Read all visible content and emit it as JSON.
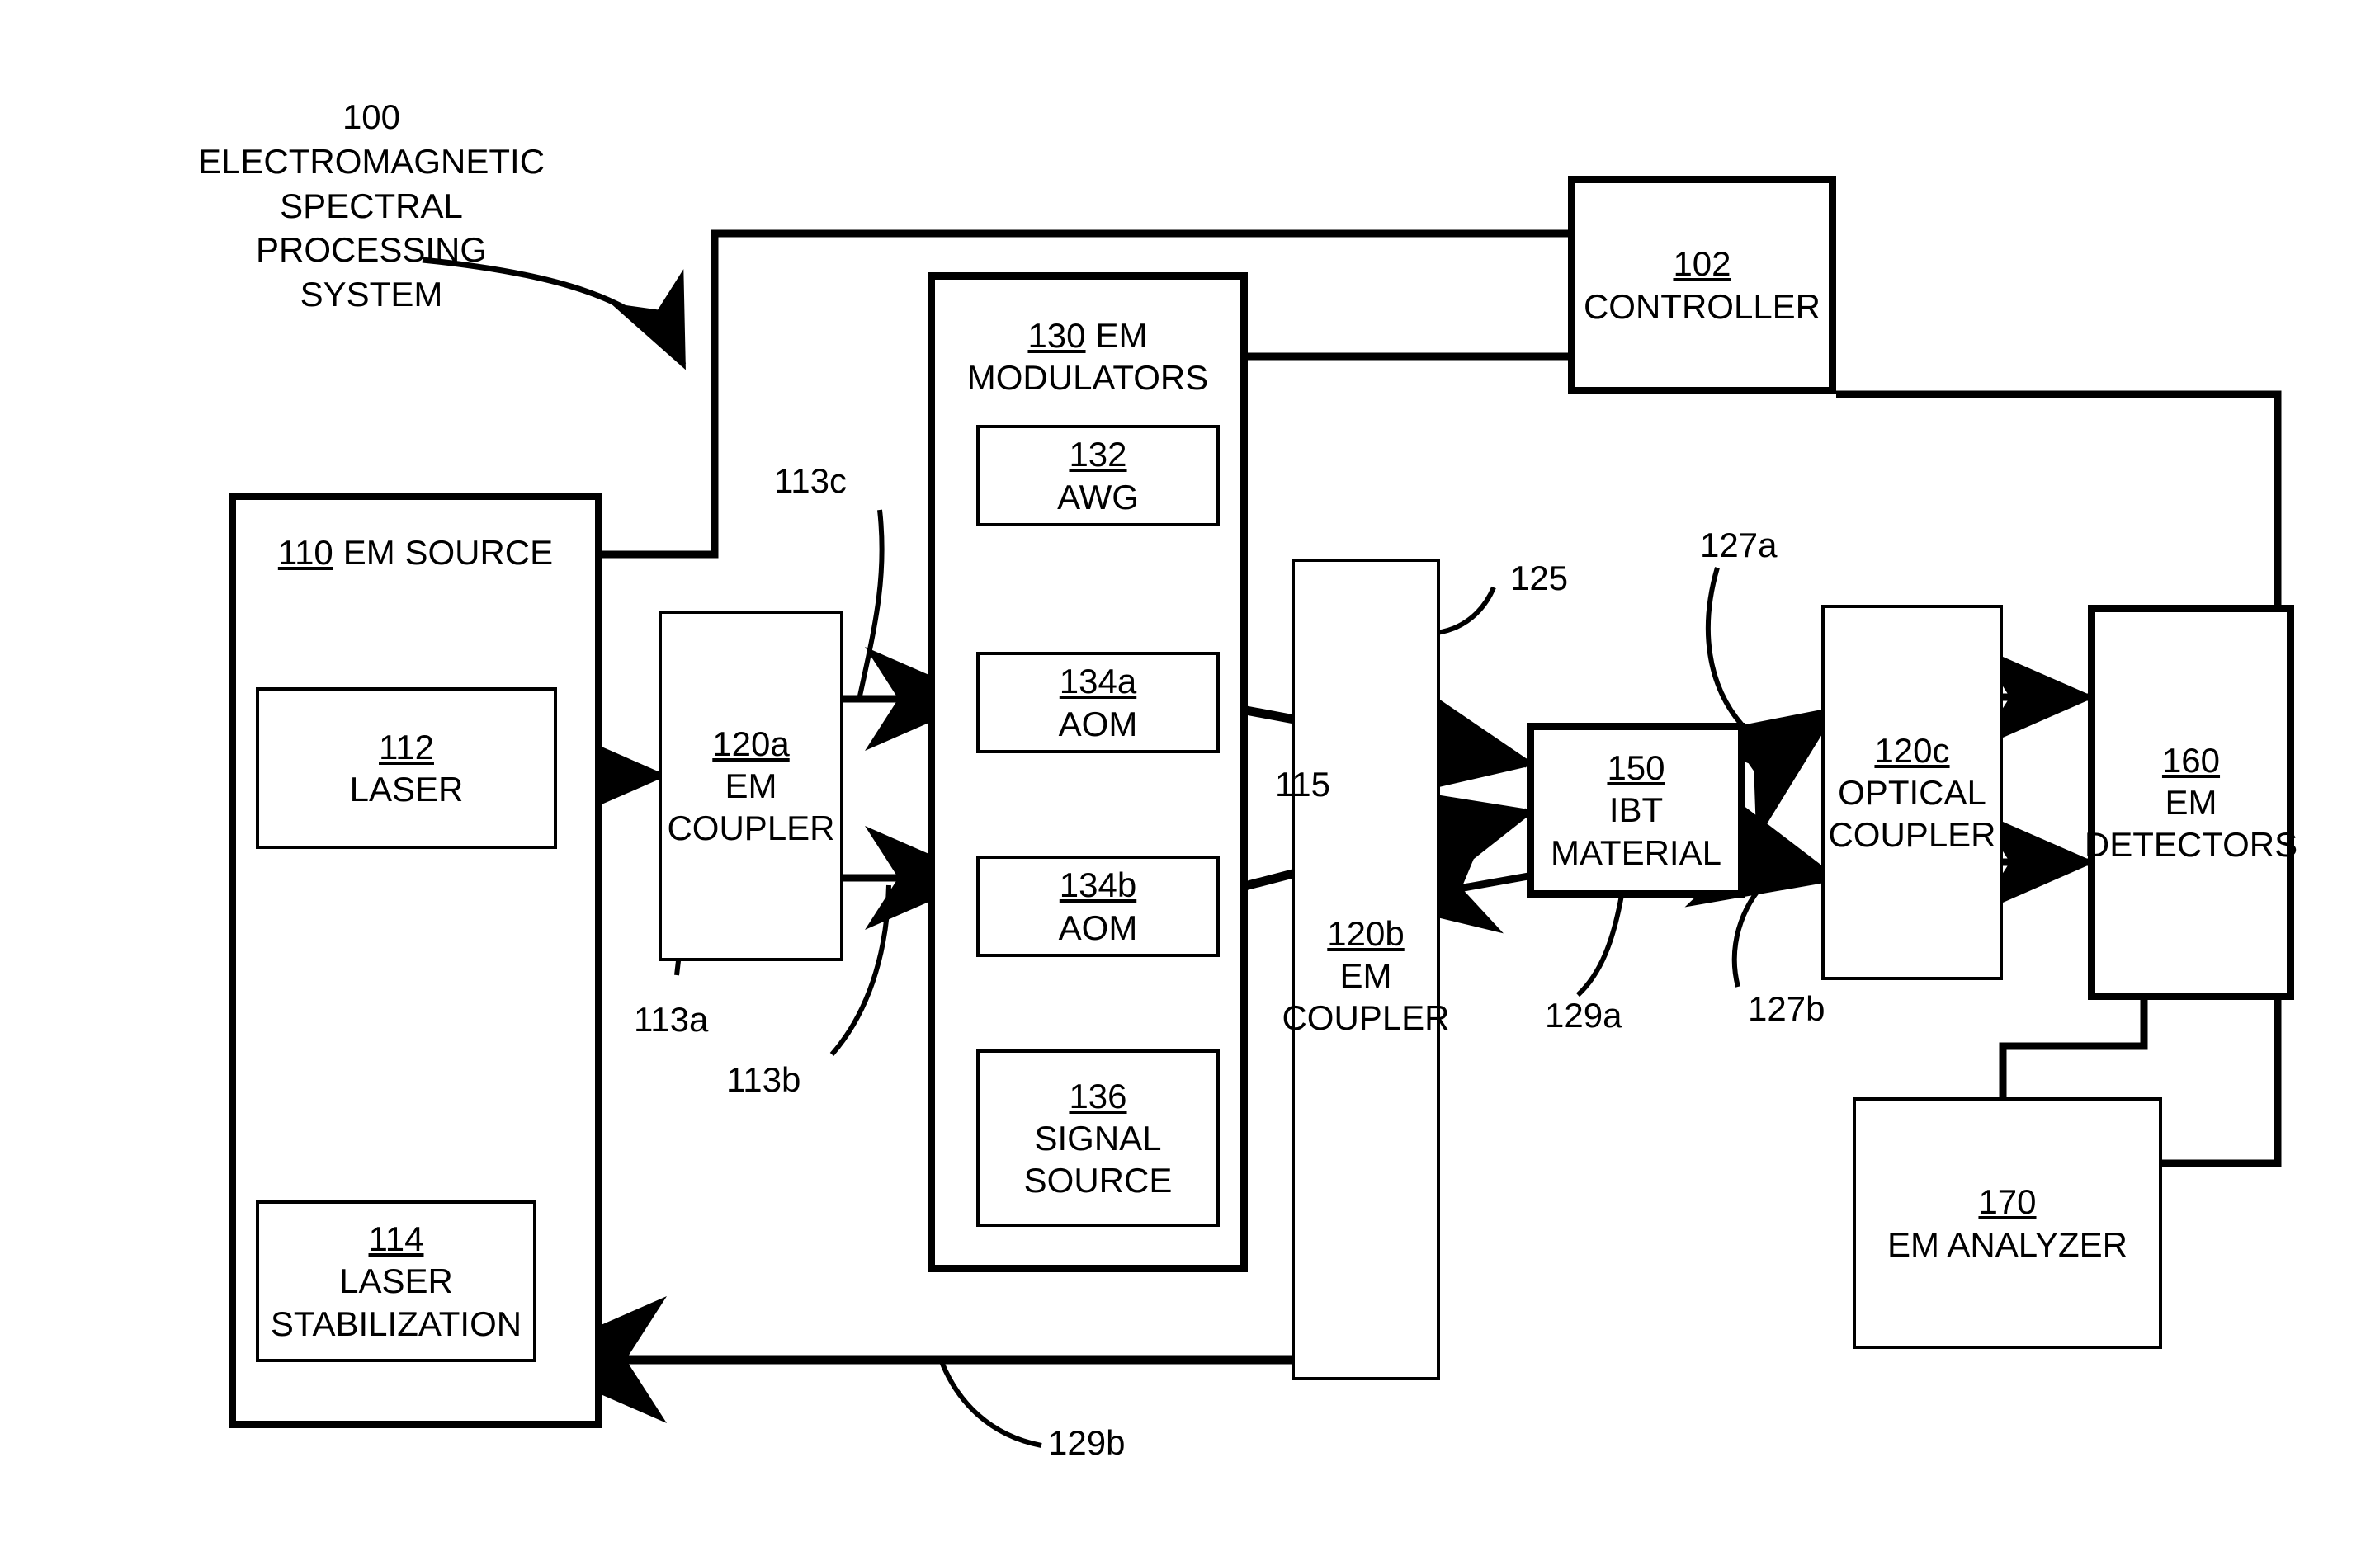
{
  "figure": {
    "title_ref": "100",
    "title_lines": [
      "ELECTROMAGNETIC",
      "SPECTRAL",
      "PROCESSING",
      "SYSTEM"
    ]
  },
  "blocks": {
    "controller": {
      "ref": "102",
      "lines": [
        "CONTROLLER"
      ]
    },
    "em_source": {
      "ref": "110",
      "inline_label": "EM SOURCE"
    },
    "laser": {
      "ref": "112",
      "lines": [
        "LASER"
      ]
    },
    "laser_stab": {
      "ref": "114",
      "lines": [
        "LASER",
        "STABILIZATION"
      ]
    },
    "em_coupler_a": {
      "ref": "120a",
      "lines": [
        "EM",
        "COUPLER"
      ]
    },
    "em_modulators": {
      "ref": "130",
      "inline_label": "EM",
      "lines": [
        "MODULATORS"
      ]
    },
    "awg": {
      "ref": "132",
      "lines": [
        "AWG"
      ]
    },
    "aom_a": {
      "ref": "134a",
      "lines": [
        "AOM"
      ]
    },
    "aom_b": {
      "ref": "134b",
      "lines": [
        "AOM"
      ]
    },
    "signal_source": {
      "ref": "136",
      "lines": [
        "SIGNAL",
        "SOURCE"
      ]
    },
    "em_coupler_b": {
      "ref": "120b",
      "lines": [
        "EM",
        "COUPLER"
      ]
    },
    "ibt_material": {
      "ref": "150",
      "lines": [
        "IBT",
        "MATERIAL"
      ]
    },
    "optical_coupler_c": {
      "ref": "120c",
      "lines": [
        "OPTICAL",
        "COUPLER"
      ]
    },
    "em_detectors": {
      "ref": "160",
      "lines": [
        "EM",
        "DETECTORS"
      ]
    },
    "em_analyzer": {
      "ref": "170",
      "inline_label": "EM ANALYZER"
    }
  },
  "callouts": {
    "c113a": "113a",
    "c113b": "113b",
    "c113c": "113c",
    "c115": "115",
    "c125": "125",
    "c127a": "127a",
    "c127b": "127b",
    "c129a": "129a",
    "c129b": "129b"
  },
  "style": {
    "line_color": "#000000",
    "background": "#ffffff"
  }
}
